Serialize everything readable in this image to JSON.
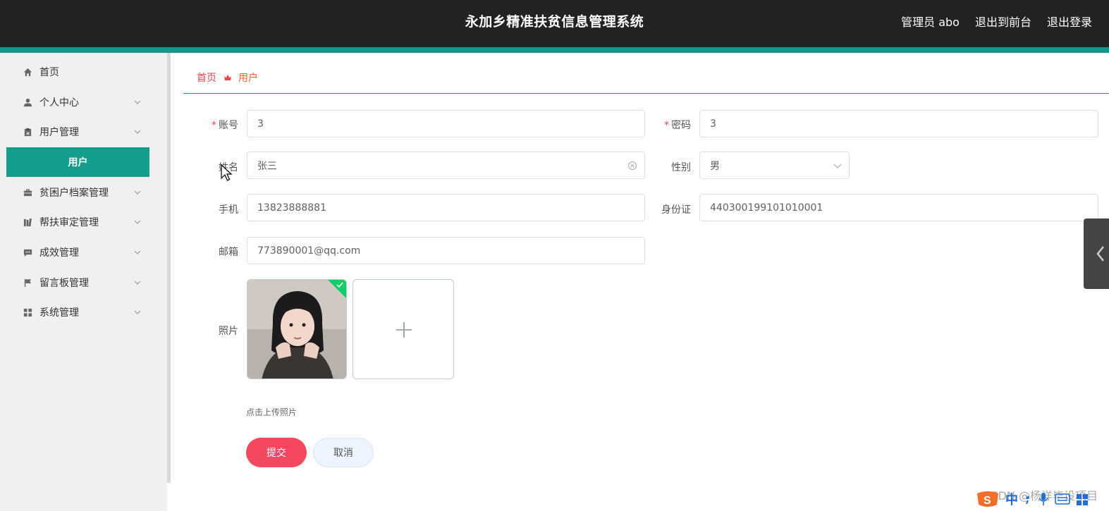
{
  "header": {
    "title": "永加乡精准扶贫信息管理系统",
    "links": [
      "管理员 abo",
      "退出到前台",
      "退出登录"
    ]
  },
  "sidebar": {
    "items": [
      {
        "label": "首页",
        "icon": "home-icon",
        "has_children": false
      },
      {
        "label": "个人中心",
        "icon": "user-icon",
        "has_children": true
      },
      {
        "label": "用户管理",
        "icon": "clipboard-icon",
        "has_children": true
      },
      {
        "label": "贫困户档案管理",
        "icon": "briefcase-icon",
        "has_children": true
      },
      {
        "label": "帮扶审定管理",
        "icon": "books-icon",
        "has_children": true
      },
      {
        "label": "成效管理",
        "icon": "chat-icon",
        "has_children": true
      },
      {
        "label": "留言板管理",
        "icon": "flag-icon",
        "has_children": true
      },
      {
        "label": "系统管理",
        "icon": "grid-icon",
        "has_children": true
      }
    ],
    "active_subitem": "用户"
  },
  "breadcrumb": {
    "home": "首页",
    "current": "用户"
  },
  "form": {
    "account": {
      "label": "账号",
      "value": "3",
      "required": true
    },
    "password": {
      "label": "密码",
      "value": "3",
      "required": true
    },
    "name": {
      "label": "姓名",
      "value": "张三"
    },
    "gender": {
      "label": "性别",
      "value": "男"
    },
    "phone": {
      "label": "手机",
      "value": "13823888881"
    },
    "id_card": {
      "label": "身份证",
      "value": "440300199101010001"
    },
    "email": {
      "label": "邮箱",
      "value": "773890001@qq.com"
    },
    "photo": {
      "label": "照片",
      "hint": "点击上传照片"
    }
  },
  "buttons": {
    "submit": "提交",
    "cancel": "取消"
  },
  "watermark": "CSDN @杨洋毕设项目",
  "ime": {
    "lang": "中"
  },
  "colors": {
    "header_bg": "#222222",
    "accent": "#11998e",
    "active_menu": "#139d8b",
    "submit": "#f5475d",
    "breadcrumb_home": "#e8464d"
  }
}
